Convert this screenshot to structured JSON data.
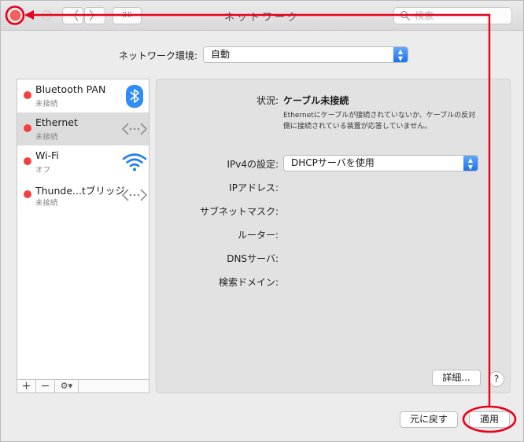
{
  "window": {
    "title": "ネットワーク",
    "search_placeholder": "検索",
    "back_glyph": "〈",
    "forward_glyph": "〉",
    "grid_glyph": "⠿⠿"
  },
  "location": {
    "label": "ネットワーク環境:",
    "value": "自動"
  },
  "services": [
    {
      "name": "Bluetooth PAN",
      "status": "未接続",
      "icon": "bluetooth-icon"
    },
    {
      "name": "Ethernet",
      "status": "未接続",
      "icon": "ethernet-icon"
    },
    {
      "name": "Wi-Fi",
      "status": "オフ",
      "icon": "wifi-icon"
    },
    {
      "name": "Thunde...tブリッジ",
      "status": "未接続",
      "icon": "thunderbolt-bridge-icon"
    }
  ],
  "sidebar_tools": {
    "add": "+",
    "remove": "−",
    "gear": "⚙▾"
  },
  "detail": {
    "status_label": "状況:",
    "status_value": "ケーブル未接続",
    "status_desc": "Ethernetにケーブルが接続されていないか、ケーブルの反対側に接続されている装置が応答していません。",
    "ipv4_label": "IPv4の設定:",
    "ipv4_value": "DHCPサーバを使用",
    "ip_label": "IPアドレス:",
    "subnet_label": "サブネットマスク:",
    "router_label": "ルーター:",
    "dns_label": "DNSサーバ:",
    "search_domain_label": "検索ドメイン:",
    "advanced_label": "詳細...",
    "help_label": "?"
  },
  "footer": {
    "revert_label": "元に戻す",
    "apply_label": "適用"
  },
  "colors": {
    "annotation": "#e8001c",
    "status_dot": "#f24141",
    "accent": "#1a73eb",
    "bluetooth": "#2f8cf6",
    "wifi": "#1e7ff0"
  }
}
